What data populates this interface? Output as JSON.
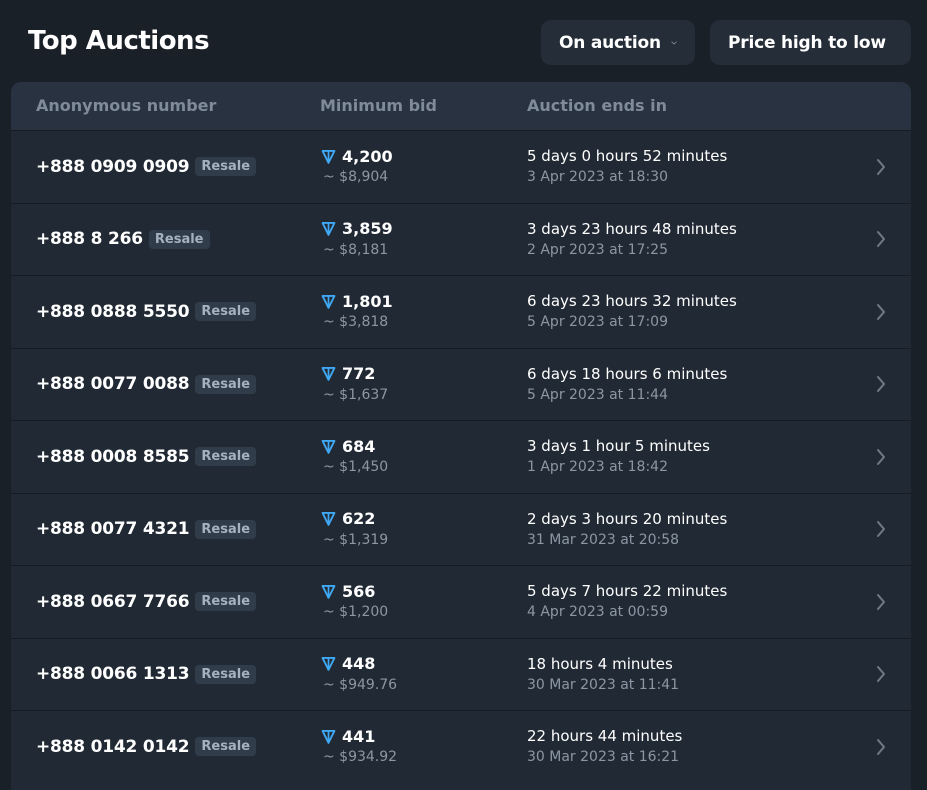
{
  "header": {
    "title": "Top Auctions",
    "status_filter": "On auction",
    "sort_filter": "Price high to low"
  },
  "table": {
    "columns": [
      "Anonymous number",
      "Minimum bid",
      "Auction ends in"
    ],
    "rows": [
      {
        "number": "+888 0909 0909",
        "badge": "Resale",
        "bid": "4,200",
        "usd": "~ $8,904",
        "ends_in": "5 days 0 hours 52 minutes",
        "ends_at": "3 Apr 2023 at 18:30"
      },
      {
        "number": "+888 8 266",
        "badge": "Resale",
        "bid": "3,859",
        "usd": "~ $8,181",
        "ends_in": "3 days 23 hours 48 minutes",
        "ends_at": "2 Apr 2023 at 17:25"
      },
      {
        "number": "+888 0888 5550",
        "badge": "Resale",
        "bid": "1,801",
        "usd": "~ $3,818",
        "ends_in": "6 days 23 hours 32 minutes",
        "ends_at": "5 Apr 2023 at 17:09"
      },
      {
        "number": "+888 0077 0088",
        "badge": "Resale",
        "bid": "772",
        "usd": "~ $1,637",
        "ends_in": "6 days 18 hours 6 minutes",
        "ends_at": "5 Apr 2023 at 11:44"
      },
      {
        "number": "+888 0008 8585",
        "badge": "Resale",
        "bid": "684",
        "usd": "~ $1,450",
        "ends_in": "3 days 1 hour 5 minutes",
        "ends_at": "1 Apr 2023 at 18:42"
      },
      {
        "number": "+888 0077 4321",
        "badge": "Resale",
        "bid": "622",
        "usd": "~ $1,319",
        "ends_in": "2 days 3 hours 20 minutes",
        "ends_at": "31 Mar 2023 at 20:58"
      },
      {
        "number": "+888 0667 7766",
        "badge": "Resale",
        "bid": "566",
        "usd": "~ $1,200",
        "ends_in": "5 days 7 hours 22 minutes",
        "ends_at": "4 Apr 2023 at 00:59"
      },
      {
        "number": "+888 0066 1313",
        "badge": "Resale",
        "bid": "448",
        "usd": "~ $949.76",
        "ends_in": "18 hours 4 minutes",
        "ends_at": "30 Mar 2023 at 11:41"
      },
      {
        "number": "+888 0142 0142",
        "badge": "Resale",
        "bid": "441",
        "usd": "~ $934.92",
        "ends_in": "22 hours 44 minutes",
        "ends_at": "30 Mar 2023 at 16:21"
      }
    ]
  },
  "icons": {
    "currency": "ton-diamond-icon",
    "dropdown": "chevron-down-icon",
    "row_open": "chevron-right-icon"
  },
  "colors": {
    "background": "#1a2028",
    "table": "#212a34",
    "header_row": "#283240",
    "ton_blue": "#3fa9f5",
    "muted_text": "#8c97a4"
  }
}
